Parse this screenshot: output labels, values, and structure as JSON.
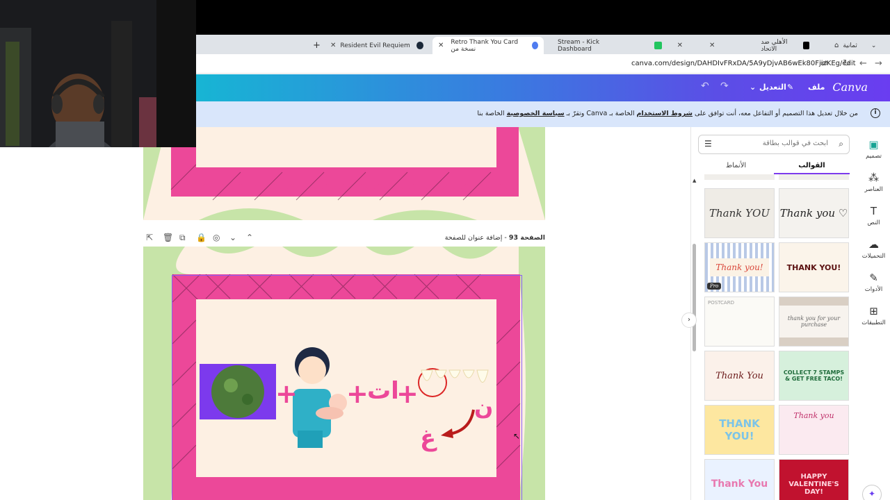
{
  "browser": {
    "tabs": [
      {
        "label": "ثمانية",
        "icon": "home-icon"
      },
      {
        "label": "الأهلي ضد الاتحاد",
        "icon": "kick-icon"
      },
      {
        "label": "Stream - Kick Dashboard",
        "icon": "kick-icon"
      },
      {
        "label": "Retro Thank You Card نسخة من",
        "icon": "canva-icon"
      },
      {
        "label": "Resident Evil Requiem على Steam",
        "icon": "steam-icon"
      }
    ],
    "new_tab": "+",
    "url": "canva.com/design/DAHDIvFRxDA/5A9yDjvAB6wEk80FjizKEg/edit"
  },
  "header": {
    "logo": "Canva",
    "file_menu": "ملف",
    "edit_menu": "التعديل"
  },
  "banner": {
    "prefix": "من خلال تعديل هذا التصميم أو التفاعل معه، أنت توافق على",
    "terms_link": "شروط الاستخدام",
    "middle": "الخاصة بـ Canva وتقرّ بـ",
    "privacy_link": "سياسة الخصوصية",
    "suffix": "الخاصة بنا"
  },
  "page": {
    "number_label": "الصفحة 93",
    "title_placeholder": "- إضافة عنوان للصفحة"
  },
  "puzzle": {
    "plus": "+",
    "at_text": "ات",
    "noon": "ن",
    "ghain": "غ"
  },
  "panel": {
    "search_placeholder": "ابحث في قوالب بطاقة",
    "tabs": [
      "القوالب",
      "الأنماط"
    ],
    "pro_badge": "Pro",
    "thumbnails": [
      {
        "text": "Thank YOU"
      },
      {
        "text": "Thank you ♡"
      },
      {
        "text": "Thank you!"
      },
      {
        "text": "THANK YOU!"
      },
      {
        "text": "POSTCARD"
      },
      {
        "text": "thank you for your purchase"
      },
      {
        "text": "Thank You"
      },
      {
        "text": "COLLECT 7 STAMPS & GET FREE TACO!"
      },
      {
        "text": "THANK YOU!"
      },
      {
        "text": "Thank you"
      },
      {
        "text": "Thank You"
      },
      {
        "text": "HAPPY VALENTINE'S DAY!"
      }
    ]
  },
  "rail": {
    "items": [
      {
        "label": "تصميم",
        "icon": "design-icon"
      },
      {
        "label": "العناصر",
        "icon": "elements-icon"
      },
      {
        "label": "النص",
        "icon": "text-icon"
      },
      {
        "label": "التحميلات",
        "icon": "upload-icon"
      },
      {
        "label": "الأدوات",
        "icon": "tools-icon"
      },
      {
        "label": "التطبيقات",
        "icon": "apps-icon"
      }
    ]
  },
  "colors": {
    "canva_gradient_start": "#17b5d4",
    "canva_gradient_end": "#6a3df0",
    "banner_bg": "#d9e6fb",
    "card_pink": "#ec4899",
    "card_cream": "#fdf0e3",
    "card_green": "#c7e4a8",
    "selection": "#8b5cf6"
  }
}
